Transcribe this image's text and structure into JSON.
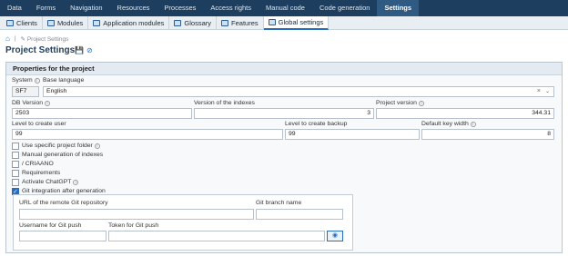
{
  "topnav": [
    "Data",
    "Forms",
    "Navigation",
    "Resources",
    "Processes",
    "Access rights",
    "Manual code",
    "Code generation",
    "Settings"
  ],
  "topnav_active": "Settings",
  "subtabs": [
    "Clients",
    "Modules",
    "Application modules",
    "Glossary",
    "Features",
    "Global settings"
  ],
  "subtabs_active": "Global settings",
  "breadcrumb": {
    "sep": "|",
    "item": "Project Settings"
  },
  "page_title": "Project Settings",
  "panel": {
    "title": "Properties for the project",
    "system_label": "System",
    "system_value": "SF7",
    "base_language_label": "Base language",
    "base_language_value": "English",
    "db_version_label": "DB Version",
    "db_version_value": "2503",
    "index_version_label": "Version of the indexes",
    "index_version_value": "3",
    "project_version_label": "Project version",
    "project_version_value": "344.31",
    "create_user_label": "Level to create user",
    "create_user_value": "99",
    "create_backup_label": "Level to create backup",
    "create_backup_value": "99",
    "key_width_label": "Default key width",
    "key_width_value": "8",
    "checkboxes": [
      {
        "label": "Use specific project folder",
        "checked": false,
        "info": true
      },
      {
        "label": "Manual generation of indexes",
        "checked": false,
        "info": false
      },
      {
        "label": "/ CRIAANO",
        "checked": false,
        "info": false
      },
      {
        "label": "Requirements",
        "checked": false,
        "info": false
      },
      {
        "label": "Activate ChatGPT",
        "checked": false,
        "info": true
      },
      {
        "label": "Git integration after generation",
        "checked": true,
        "info": false
      }
    ],
    "git": {
      "repo_label": "URL of the remote Git repository",
      "repo_value": "",
      "branch_label": "Git branch name",
      "branch_value": "",
      "user_label": "Username for Git push",
      "user_value": "",
      "token_label": "Token for Git push",
      "token_value": ""
    }
  },
  "colors": {
    "nav_bg": "#1d3e5e",
    "accent": "#2a6ebb"
  },
  "icons": {
    "home": "home-icon",
    "save": "save-icon",
    "cancel": "cancel-icon",
    "eye": "eye-icon",
    "info": "info-icon"
  }
}
